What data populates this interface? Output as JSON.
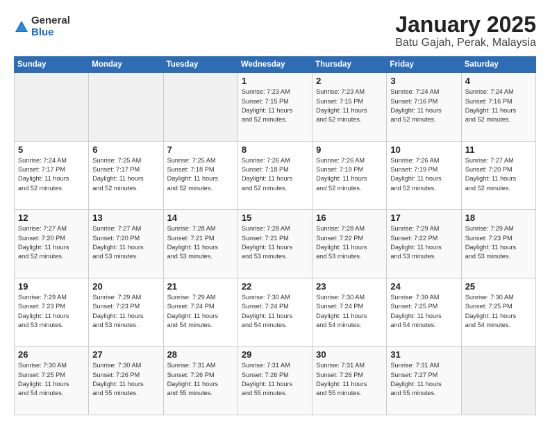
{
  "logo": {
    "general": "General",
    "blue": "Blue"
  },
  "title": "January 2025",
  "subtitle": "Batu Gajah, Perak, Malaysia",
  "days_header": [
    "Sunday",
    "Monday",
    "Tuesday",
    "Wednesday",
    "Thursday",
    "Friday",
    "Saturday"
  ],
  "weeks": [
    [
      {
        "day": "",
        "info": ""
      },
      {
        "day": "",
        "info": ""
      },
      {
        "day": "",
        "info": ""
      },
      {
        "day": "1",
        "info": "Sunrise: 7:23 AM\nSunset: 7:15 PM\nDaylight: 11 hours\nand 52 minutes."
      },
      {
        "day": "2",
        "info": "Sunrise: 7:23 AM\nSunset: 7:15 PM\nDaylight: 11 hours\nand 52 minutes."
      },
      {
        "day": "3",
        "info": "Sunrise: 7:24 AM\nSunset: 7:16 PM\nDaylight: 11 hours\nand 52 minutes."
      },
      {
        "day": "4",
        "info": "Sunrise: 7:24 AM\nSunset: 7:16 PM\nDaylight: 11 hours\nand 52 minutes."
      }
    ],
    [
      {
        "day": "5",
        "info": "Sunrise: 7:24 AM\nSunset: 7:17 PM\nDaylight: 11 hours\nand 52 minutes."
      },
      {
        "day": "6",
        "info": "Sunrise: 7:25 AM\nSunset: 7:17 PM\nDaylight: 11 hours\nand 52 minutes."
      },
      {
        "day": "7",
        "info": "Sunrise: 7:25 AM\nSunset: 7:18 PM\nDaylight: 11 hours\nand 52 minutes."
      },
      {
        "day": "8",
        "info": "Sunrise: 7:26 AM\nSunset: 7:18 PM\nDaylight: 11 hours\nand 52 minutes."
      },
      {
        "day": "9",
        "info": "Sunrise: 7:26 AM\nSunset: 7:19 PM\nDaylight: 11 hours\nand 52 minutes."
      },
      {
        "day": "10",
        "info": "Sunrise: 7:26 AM\nSunset: 7:19 PM\nDaylight: 11 hours\nand 52 minutes."
      },
      {
        "day": "11",
        "info": "Sunrise: 7:27 AM\nSunset: 7:20 PM\nDaylight: 11 hours\nand 52 minutes."
      }
    ],
    [
      {
        "day": "12",
        "info": "Sunrise: 7:27 AM\nSunset: 7:20 PM\nDaylight: 11 hours\nand 52 minutes."
      },
      {
        "day": "13",
        "info": "Sunrise: 7:27 AM\nSunset: 7:20 PM\nDaylight: 11 hours\nand 53 minutes."
      },
      {
        "day": "14",
        "info": "Sunrise: 7:28 AM\nSunset: 7:21 PM\nDaylight: 11 hours\nand 53 minutes."
      },
      {
        "day": "15",
        "info": "Sunrise: 7:28 AM\nSunset: 7:21 PM\nDaylight: 11 hours\nand 53 minutes."
      },
      {
        "day": "16",
        "info": "Sunrise: 7:28 AM\nSunset: 7:22 PM\nDaylight: 11 hours\nand 53 minutes."
      },
      {
        "day": "17",
        "info": "Sunrise: 7:29 AM\nSunset: 7:22 PM\nDaylight: 11 hours\nand 53 minutes."
      },
      {
        "day": "18",
        "info": "Sunrise: 7:29 AM\nSunset: 7:23 PM\nDaylight: 11 hours\nand 53 minutes."
      }
    ],
    [
      {
        "day": "19",
        "info": "Sunrise: 7:29 AM\nSunset: 7:23 PM\nDaylight: 11 hours\nand 53 minutes."
      },
      {
        "day": "20",
        "info": "Sunrise: 7:29 AM\nSunset: 7:23 PM\nDaylight: 11 hours\nand 53 minutes."
      },
      {
        "day": "21",
        "info": "Sunrise: 7:29 AM\nSunset: 7:24 PM\nDaylight: 11 hours\nand 54 minutes."
      },
      {
        "day": "22",
        "info": "Sunrise: 7:30 AM\nSunset: 7:24 PM\nDaylight: 11 hours\nand 54 minutes."
      },
      {
        "day": "23",
        "info": "Sunrise: 7:30 AM\nSunset: 7:24 PM\nDaylight: 11 hours\nand 54 minutes."
      },
      {
        "day": "24",
        "info": "Sunrise: 7:30 AM\nSunset: 7:25 PM\nDaylight: 11 hours\nand 54 minutes."
      },
      {
        "day": "25",
        "info": "Sunrise: 7:30 AM\nSunset: 7:25 PM\nDaylight: 11 hours\nand 54 minutes."
      }
    ],
    [
      {
        "day": "26",
        "info": "Sunrise: 7:30 AM\nSunset: 7:25 PM\nDaylight: 11 hours\nand 54 minutes."
      },
      {
        "day": "27",
        "info": "Sunrise: 7:30 AM\nSunset: 7:26 PM\nDaylight: 11 hours\nand 55 minutes."
      },
      {
        "day": "28",
        "info": "Sunrise: 7:31 AM\nSunset: 7:26 PM\nDaylight: 11 hours\nand 55 minutes."
      },
      {
        "day": "29",
        "info": "Sunrise: 7:31 AM\nSunset: 7:26 PM\nDaylight: 11 hours\nand 55 minutes."
      },
      {
        "day": "30",
        "info": "Sunrise: 7:31 AM\nSunset: 7:26 PM\nDaylight: 11 hours\nand 55 minutes."
      },
      {
        "day": "31",
        "info": "Sunrise: 7:31 AM\nSunset: 7:27 PM\nDaylight: 11 hours\nand 55 minutes."
      },
      {
        "day": "",
        "info": ""
      }
    ]
  ]
}
